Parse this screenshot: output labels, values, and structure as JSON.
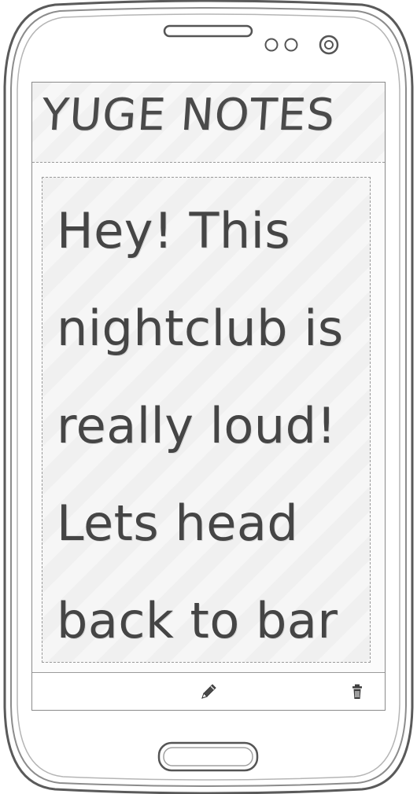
{
  "app": {
    "title": "YUGE NOTES"
  },
  "note": {
    "text": "Hey! This nightclub is really loud! Lets head back to bar"
  },
  "toolbar": {
    "edit_icon": "pencil-icon",
    "delete_icon": "trash-icon"
  },
  "colors": {
    "ink": "#454545",
    "outline": "#555555",
    "screen_background": "#fbfbfb"
  }
}
